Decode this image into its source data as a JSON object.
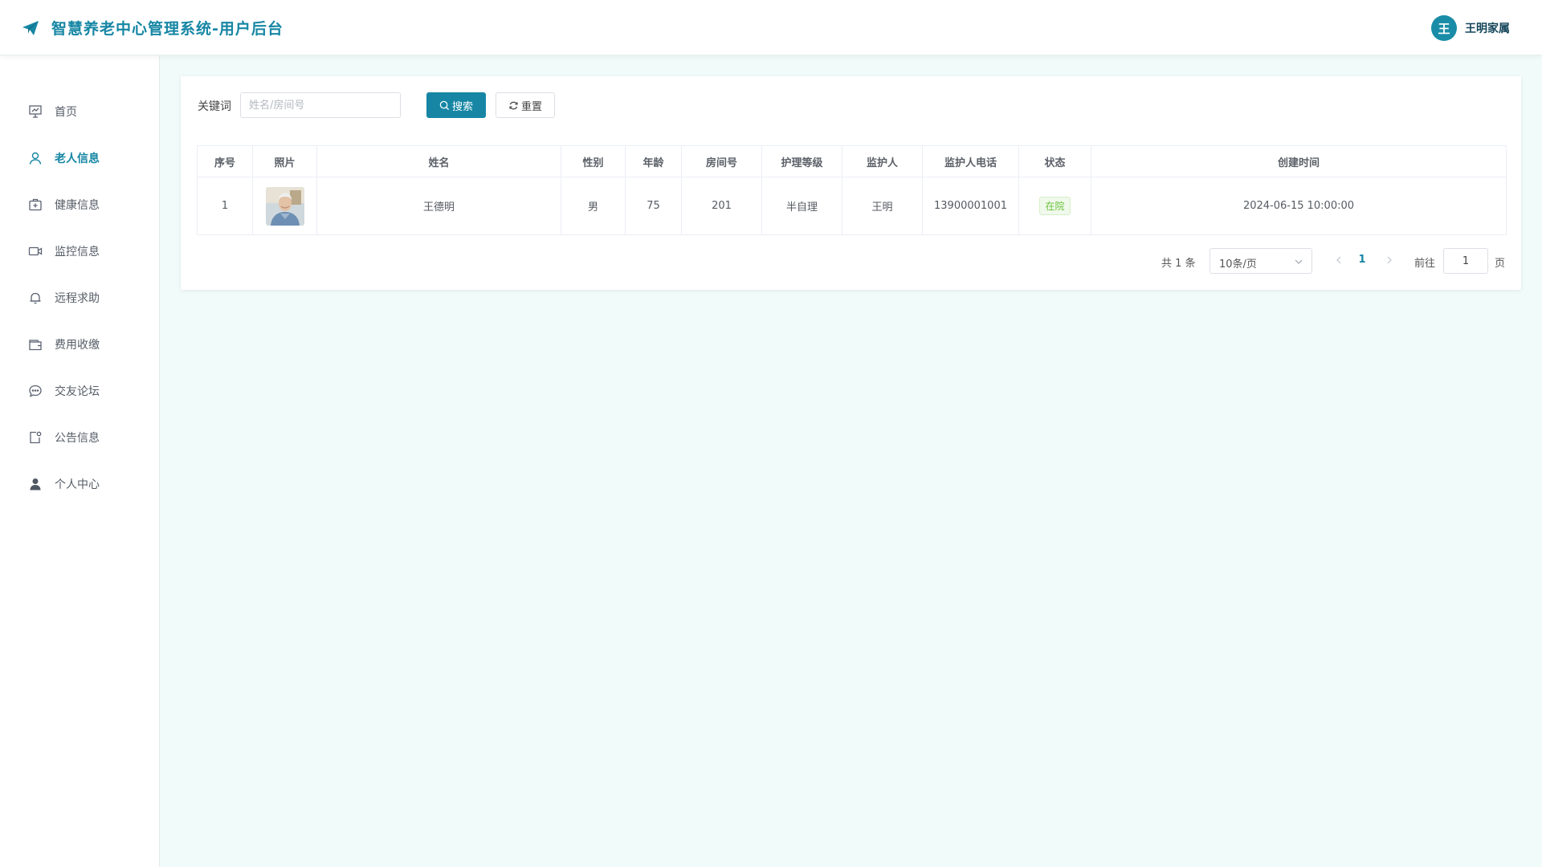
{
  "header": {
    "app_title": "智慧养老中心管理系统-用户后台",
    "user_avatar_letter": "王",
    "user_name": "王明家属"
  },
  "sidebar": {
    "items": [
      {
        "label": "首页",
        "icon": "presentation-chart-icon",
        "active": false
      },
      {
        "label": "老人信息",
        "icon": "user-icon",
        "active": true
      },
      {
        "label": "健康信息",
        "icon": "first-aid-kit-icon",
        "active": false
      },
      {
        "label": "监控信息",
        "icon": "video-camera-icon",
        "active": false
      },
      {
        "label": "远程求助",
        "icon": "bell-icon",
        "active": false
      },
      {
        "label": "费用收缴",
        "icon": "wallet-icon",
        "active": false
      },
      {
        "label": "交友论坛",
        "icon": "chat-bubble-icon",
        "active": false
      },
      {
        "label": "公告信息",
        "icon": "notice-icon",
        "active": false
      },
      {
        "label": "个人中心",
        "icon": "user-filled-icon",
        "active": false
      }
    ]
  },
  "search": {
    "keyword_label": "关键词",
    "keyword_placeholder": "姓名/房间号",
    "keyword_value": "",
    "search_label": "搜索",
    "reset_label": "重置"
  },
  "table": {
    "columns": [
      "序号",
      "照片",
      "姓名",
      "性别",
      "年龄",
      "房间号",
      "护理等级",
      "监护人",
      "监护人电话",
      "状态",
      "创建时间"
    ],
    "rows": [
      {
        "index": "1",
        "photo": "elderly-man-portrait",
        "name": "王德明",
        "gender": "男",
        "age": "75",
        "room": "201",
        "care_level": "半自理",
        "guardian": "王明",
        "guardian_phone": "13900001001",
        "status": "在院",
        "created_at": "2024-06-15 10:00:00"
      }
    ]
  },
  "pagination": {
    "total_text": "共 1 条",
    "page_size": "10条/页",
    "current_page": "1",
    "goto_label": "前往",
    "goto_value": "1",
    "page_suffix": "页"
  },
  "colors": {
    "primary": "#1686a4",
    "background": "#f1fbf9",
    "status_green": "#67c23a"
  }
}
